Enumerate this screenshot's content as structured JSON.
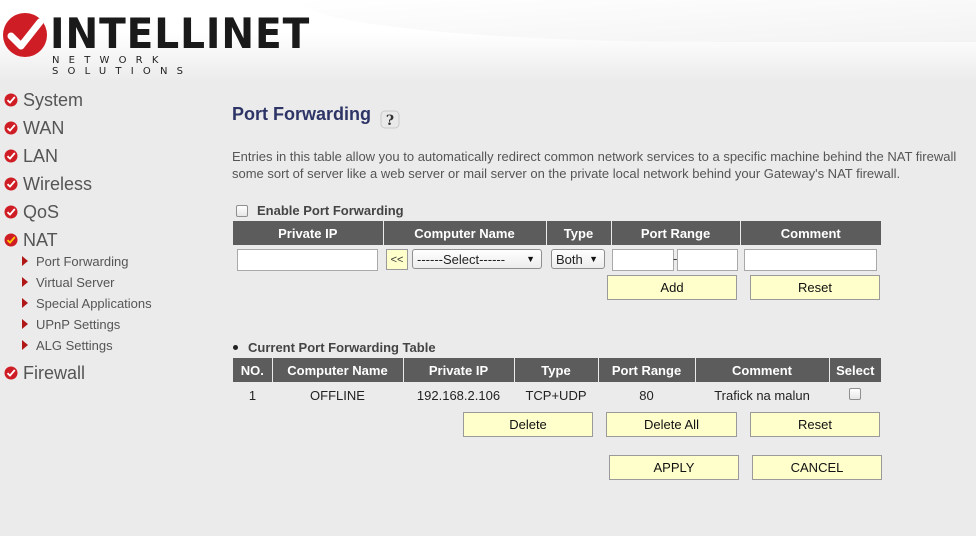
{
  "brand": {
    "name": "INTELLINET",
    "tagline": "NETWORK SOLUTIONS",
    "accent": "#cf1d25"
  },
  "sidebar": {
    "items": [
      {
        "label": "System"
      },
      {
        "label": "WAN"
      },
      {
        "label": "LAN"
      },
      {
        "label": "Wireless"
      },
      {
        "label": "QoS"
      },
      {
        "label": "NAT",
        "expanded": true
      },
      {
        "label": "Firewall"
      }
    ],
    "nat_sub": [
      {
        "label": "Port Forwarding"
      },
      {
        "label": "Virtual Server"
      },
      {
        "label": "Special Applications"
      },
      {
        "label": "UPnP Settings"
      },
      {
        "label": "ALG Settings"
      }
    ]
  },
  "main": {
    "title": "Port Forwarding",
    "help_icon": "help-icon",
    "description_line1": "Entries in this table allow you to automatically redirect common network services to a specific machine behind the NAT firewall",
    "description_line2": "some sort of server like a web server or mail server on the private local network behind your Gateway's NAT firewall.",
    "enable_label": "Enable Port Forwarding",
    "enable_checked": false,
    "form_table": {
      "headers": [
        "Private IP",
        "Computer Name",
        "Type",
        "Port Range",
        "Comment"
      ],
      "copy_button": "<<",
      "computer_select": "------Select------",
      "type_select": "Both",
      "private_ip": "",
      "port_from": "",
      "port_to": "",
      "comment": "",
      "add_label": "Add",
      "reset_label": "Reset"
    },
    "current_table": {
      "title": "Current Port Forwarding Table",
      "headers": [
        "NO.",
        "Computer Name",
        "Private IP",
        "Type",
        "Port Range",
        "Comment",
        "Select"
      ],
      "rows": [
        {
          "no": "1",
          "computer": "OFFLINE",
          "ip": "192.168.2.106",
          "type": "TCP+UDP",
          "port": "80",
          "comment": "Trafick na malun",
          "selected": false
        }
      ],
      "delete_label": "Delete",
      "delete_all_label": "Delete All",
      "reset_label": "Reset"
    },
    "apply_label": "APPLY",
    "cancel_label": "CANCEL"
  }
}
